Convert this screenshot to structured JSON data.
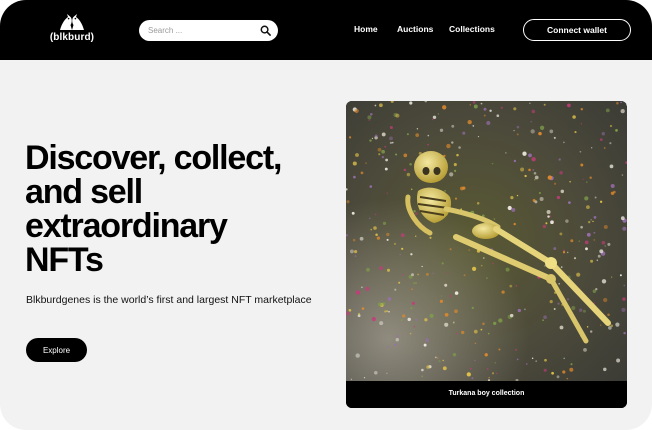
{
  "header": {
    "logo_text": "(blkburd)",
    "search_placeholder": "Search ...",
    "nav": [
      {
        "label": "Home"
      },
      {
        "label": "Auctions"
      },
      {
        "label": "Collections"
      }
    ],
    "connect_label": "Connect wallet"
  },
  "hero": {
    "headline": [
      "Discover, collect,",
      "and sell",
      "extraordinary",
      "NFTs"
    ],
    "subtitle": "Blkburdgenes is the world’s first and largest NFT marketplace",
    "cta_label": "Explore"
  },
  "featured": {
    "caption": "Turkana boy collection"
  },
  "icons": {
    "logo": "two-birds-icon",
    "search": "search-icon"
  },
  "colors": {
    "header_bg": "#000000",
    "page_bg": "#f2f2f2",
    "accent": "#000000",
    "text_on_dark": "#ffffff"
  }
}
